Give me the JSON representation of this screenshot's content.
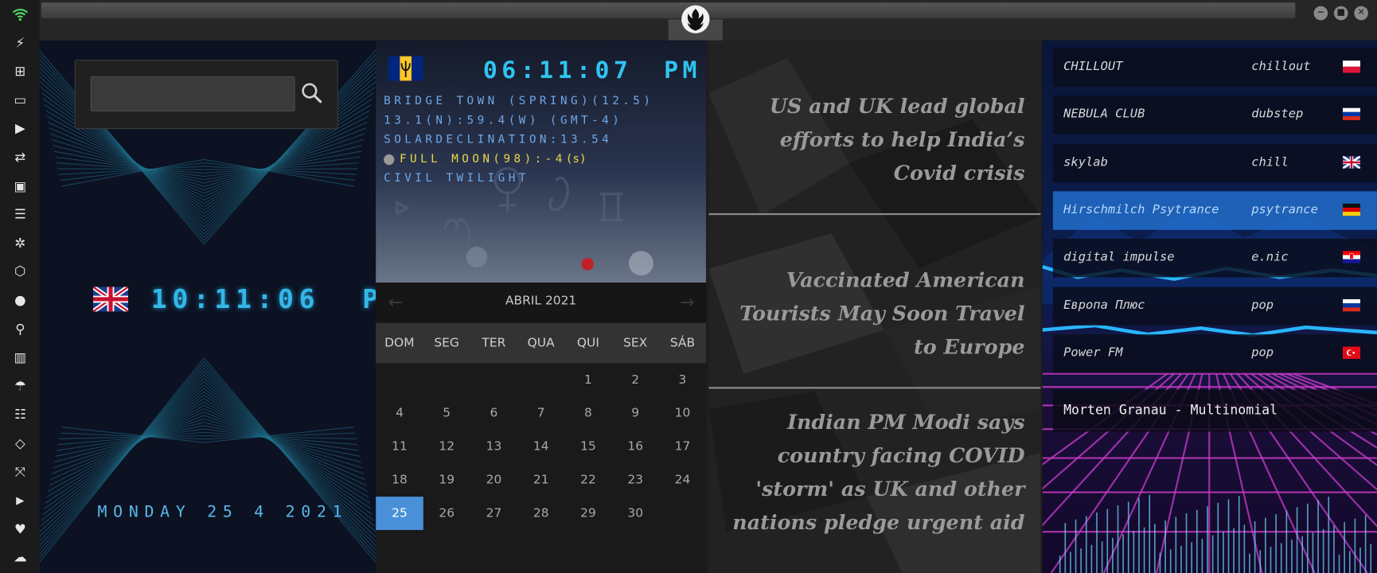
{
  "titlebar": {
    "min_glyph": "−",
    "max_glyph": "■",
    "close_glyph": "✕"
  },
  "sidebar": {
    "icons": [
      "wifi-icon",
      "bolt-icon",
      "windows-icon",
      "archive-icon",
      "play-icon",
      "translate-icon",
      "image-icon",
      "newspaper-icon",
      "settings-icon",
      "cube-icon",
      "globe-icon",
      "search-icon",
      "map-icon",
      "umbrella-icon",
      "contacts-icon",
      "code-icon",
      "expand-icon",
      "youtube-icon",
      "heart-icon",
      "cloud-icon"
    ]
  },
  "panel_time": {
    "search": {
      "placeholder": "",
      "value": ""
    },
    "clock": "10:11:06",
    "ampm": "PM",
    "date": "MONDAY 25 4 2021"
  },
  "panel_astro": {
    "clock": "06:11:07",
    "ampm": "PM",
    "location": "BRIDGE TOWN (SPRING)(12.5)",
    "coords": "13.1(N):59.4(W) (GMT-4)",
    "solar": "SOLARDECLINATION:13.54",
    "moon": "FULL MOON(98):-4",
    "moon_suffix": "(s)",
    "twilight": "CIVIL TWILIGHT",
    "colors": {
      "astro_text": "#6ea8e8",
      "moon_text": "#e8d848"
    }
  },
  "calendar": {
    "month_label": "ABRIL 2021",
    "prev": "←",
    "next": "→",
    "weekdays": [
      "DOM",
      "SEG",
      "TER",
      "QUA",
      "QUI",
      "SEX",
      "SÁB"
    ],
    "first_weekday_index": 4,
    "days_in_month": 30,
    "selected_day": 25,
    "accent": "#4a90d9"
  },
  "news": {
    "items": [
      "US and UK lead global efforts to help India’s Covid crisis",
      "Vaccinated American Tourists May Soon Travel to Europe",
      "Indian PM Modi says country facing COVID 'storm' as UK and other nations pledge urgent aid"
    ]
  },
  "radio": {
    "stations": [
      {
        "name": "CHILLOUT",
        "genre": "chillout",
        "flag": "poland"
      },
      {
        "name": "NEBULA CLUB",
        "genre": "dubstep",
        "flag": "russia"
      },
      {
        "name": "skylab",
        "genre": "chill",
        "flag": "uk"
      },
      {
        "name": "Hirschmilch Psytrance",
        "genre": "psytrance",
        "flag": "germany",
        "active": true
      },
      {
        "name": "digital impulse",
        "genre": "e.nic",
        "flag": "croatia"
      },
      {
        "name": "Европа Плюс",
        "genre": "pop",
        "flag": "russia"
      },
      {
        "name": "Power FM",
        "genre": "pop",
        "flag": "turkey"
      }
    ],
    "now_playing": "Morten Granau - Multinomial"
  }
}
